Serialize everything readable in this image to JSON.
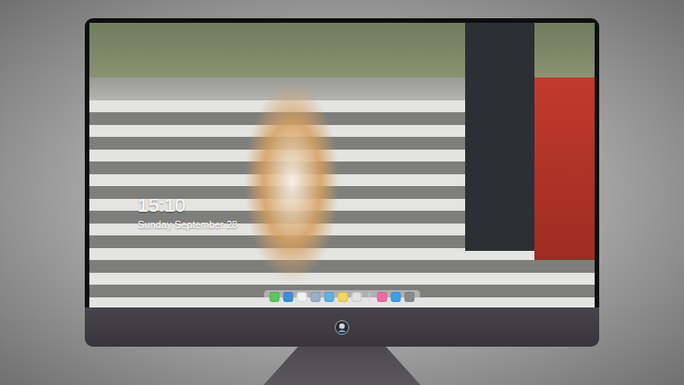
{
  "lock_screen": {
    "time": "15:10",
    "date": "Sunday September 28"
  },
  "dock": {
    "items": [
      {
        "kind": "app",
        "color": "#5ac85a"
      },
      {
        "kind": "app",
        "color": "#3b8fe0"
      },
      {
        "kind": "app",
        "color": "#f2f2f2"
      },
      {
        "kind": "app",
        "color": "#9ab0c8"
      },
      {
        "kind": "app",
        "color": "#5ab4e8"
      },
      {
        "kind": "app",
        "color": "#f5d65a"
      },
      {
        "kind": "app",
        "color": "#e2e2e2"
      },
      {
        "kind": "separator",
        "color": "#d0d0d0"
      },
      {
        "kind": "app",
        "color": "#f06aa0"
      },
      {
        "kind": "app",
        "color": "#3aa0f0"
      },
      {
        "kind": "app",
        "color": "#8a8a8a"
      }
    ]
  }
}
